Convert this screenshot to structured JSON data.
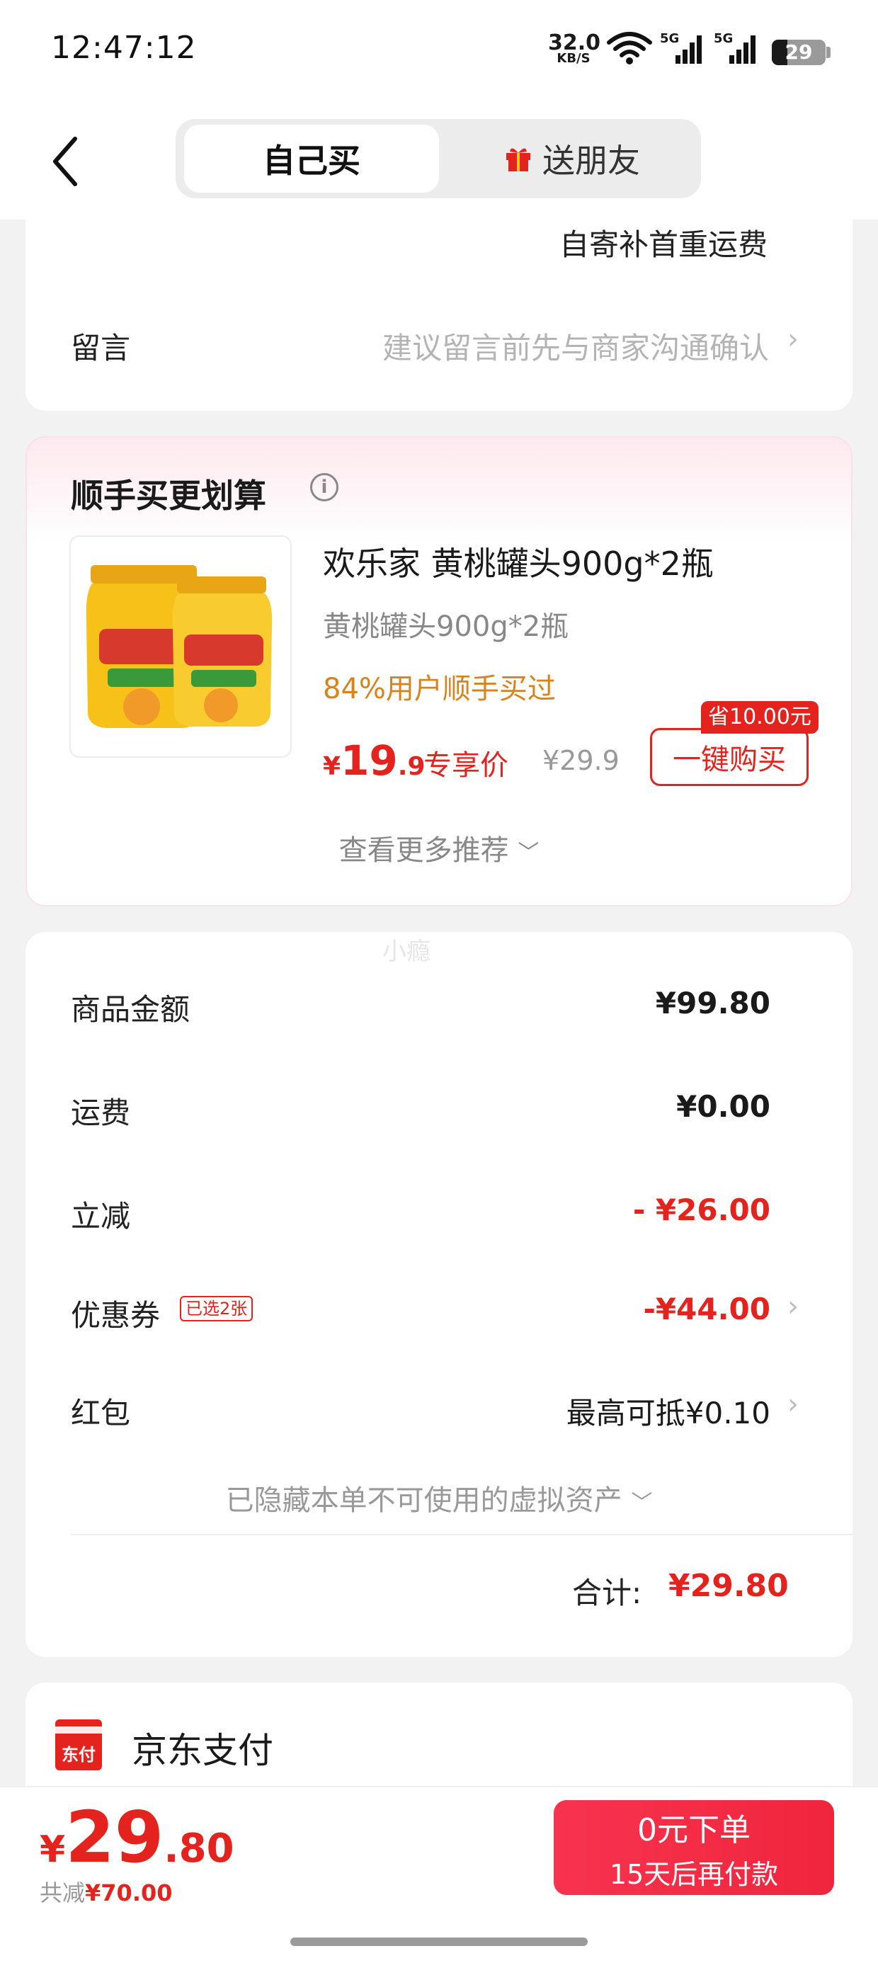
{
  "status_bar": {
    "time": "12:47:12",
    "net_speed": "32.0",
    "net_unit": "KB/S",
    "sig1": "5G",
    "sig2": "5G",
    "battery": "29",
    "battery_level": 0.29
  },
  "nav": {
    "tab_self": "自己买",
    "tab_gift": "送朋友"
  },
  "shipping_note": "自寄补首重运费",
  "message": {
    "label": "留言",
    "placeholder": "建议留言前先与商家沟通确认"
  },
  "recommend": {
    "title": "顺手买更划算",
    "product_name": "欢乐家 黄桃罐头900g*2瓶",
    "product_spec": "黄桃罐头900g*2瓶",
    "purchase_rate": "84%用户顺手买过",
    "price_symbol": "¥",
    "price_int": "19",
    "price_dec": ".9",
    "price_tag": "专享价",
    "orig_price": "¥29.9",
    "save_badge": "省10.00元",
    "buy_label": "一键购买",
    "more": "查看更多推荐"
  },
  "watermark": "小瘾",
  "summary": {
    "goods_label": "商品金额",
    "goods_value": "¥99.80",
    "shipping_label": "运费",
    "shipping_value": "¥0.00",
    "discount_label": "立减",
    "discount_value": "- ¥26.00",
    "coupon_label": "优惠券",
    "coupon_tag": "已选2张",
    "coupon_value": "-¥44.00",
    "redpack_label": "红包",
    "redpack_value": "最高可抵¥0.10",
    "hidden_assets": "已隐藏本单不可使用的虚拟资产",
    "total_label": "合计:",
    "total_value": "¥29.80"
  },
  "payment": {
    "icon_text": "东付",
    "method": "京东支付"
  },
  "bottom": {
    "symbol": "¥",
    "price_int": "29",
    "price_dec": ".80",
    "saved_label": "共减",
    "saved_amount": "¥70.00",
    "order_line1": "0元下单",
    "order_line2": "15天后再付款"
  },
  "colors": {
    "accent_red": "#e4231f",
    "order_button": "#f8334f",
    "rate_orange": "#d7831e"
  }
}
